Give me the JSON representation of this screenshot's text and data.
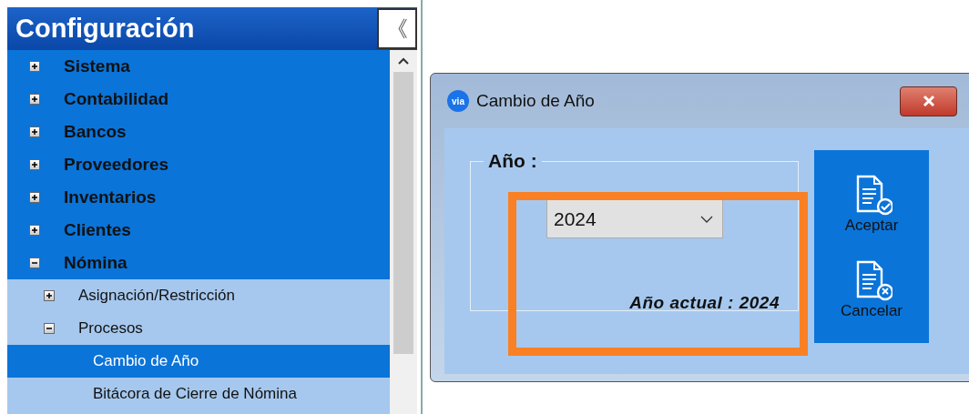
{
  "sidebar": {
    "title": "Configuración",
    "collapse_button": "《",
    "tree": [
      {
        "label": "Sistema",
        "expanded": false,
        "selected": false
      },
      {
        "label": "Contabilidad",
        "expanded": false,
        "selected": false
      },
      {
        "label": "Bancos",
        "expanded": false,
        "selected": false
      },
      {
        "label": "Proveedores",
        "expanded": false,
        "selected": false
      },
      {
        "label": "Inventarios",
        "expanded": false,
        "selected": false
      },
      {
        "label": "Clientes",
        "expanded": false,
        "selected": false
      },
      {
        "label": "Nómina",
        "expanded": true,
        "selected": false,
        "children": [
          {
            "label": "Asignación/Restricción",
            "expanded": false,
            "selected": false
          },
          {
            "label": "Procesos",
            "expanded": true,
            "selected": false,
            "children": [
              {
                "label": "Cambio de Año",
                "selected": true
              },
              {
                "label": "Bitácora de Cierre de Nómina",
                "selected": false
              }
            ]
          }
        ]
      }
    ]
  },
  "dialog": {
    "logo": "via",
    "title": "Cambio de Año",
    "group_label": "Año :",
    "year_select": {
      "value": "2024"
    },
    "current_year": "Año actual : 2024",
    "buttons": [
      {
        "kind": "accept",
        "label": "Aceptar"
      },
      {
        "kind": "cancel",
        "label": "Cancelar"
      }
    ],
    "highlight": true
  }
}
